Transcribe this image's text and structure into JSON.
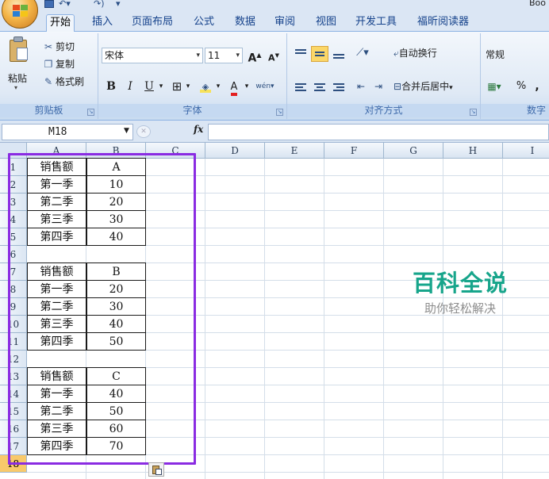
{
  "window": {
    "title_fragment": "Boo"
  },
  "ribbon": {
    "tabs": [
      "开始",
      "插入",
      "页面布局",
      "公式",
      "数据",
      "审阅",
      "视图",
      "开发工具",
      "福昕阅读器"
    ],
    "active_tab": "开始",
    "clipboard": {
      "paste": "粘贴",
      "cut": "剪切",
      "copy": "复制",
      "format_painter": "格式刷",
      "group_label": "剪贴板"
    },
    "font": {
      "name": "宋体",
      "size": "11",
      "bold": "B",
      "italic": "I",
      "underline": "U",
      "grow": "A",
      "shrink": "A",
      "phonetic": "wén",
      "group_label": "字体"
    },
    "alignment": {
      "wrap_text": "自动换行",
      "merge_center": "合并后居中",
      "group_label": "对齐方式"
    },
    "number": {
      "format": "常规",
      "percent": "%",
      "comma": ",",
      "group_label": "数字"
    }
  },
  "formula_bar": {
    "name_box": "M18",
    "fx": "fx",
    "value": ""
  },
  "grid": {
    "columns": [
      "A",
      "B",
      "C",
      "D",
      "E",
      "F",
      "G",
      "H",
      "I"
    ],
    "rows": [
      "1",
      "2",
      "3",
      "4",
      "5",
      "6",
      "7",
      "8",
      "9",
      "10",
      "11",
      "12",
      "13",
      "14",
      "15",
      "16",
      "17",
      "18"
    ],
    "selected_row": "18",
    "cells": {
      "A1": "销售额",
      "B1": "A",
      "A2": "第一季",
      "B2": "10",
      "A3": "第二季",
      "B3": "20",
      "A4": "第三季",
      "B4": "30",
      "A5": "第四季",
      "B5": "40",
      "A7": "销售额",
      "B7": "B",
      "A8": "第一季",
      "B8": "20",
      "A9": "第二季",
      "B9": "30",
      "A10": "第三季",
      "B10": "40",
      "A11": "第四季",
      "B11": "50",
      "A13": "销售额",
      "B13": "C",
      "A14": "第一季",
      "B14": "40",
      "A15": "第二季",
      "B15": "50",
      "A16": "第三季",
      "B16": "60",
      "A17": "第四季",
      "B17": "70"
    },
    "highlight_color": "#8a2be2"
  },
  "watermark": {
    "title": "百科全说",
    "subtitle": "助你轻松解决",
    "color": "#17a58b"
  }
}
